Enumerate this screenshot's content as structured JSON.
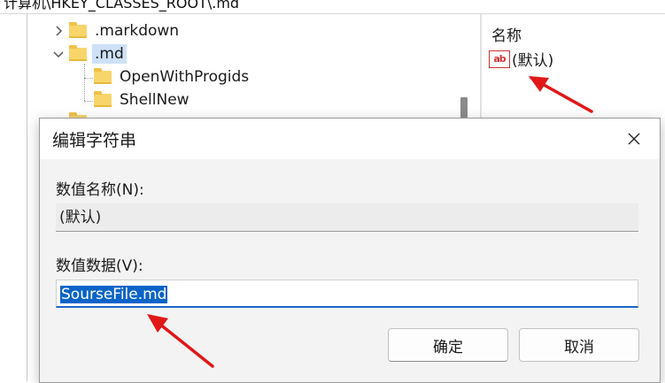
{
  "address_bar": {
    "path": "计算机\\HKEY_CLASSES_ROOT\\.md"
  },
  "tree": {
    "items": [
      {
        "label": ".markdown",
        "expanded": false
      },
      {
        "label": ".md",
        "expanded": true,
        "selected": true
      },
      {
        "label": "OpenWithProgids"
      },
      {
        "label": "ShellNew"
      }
    ]
  },
  "values_pane": {
    "column_name": "名称",
    "rows": [
      {
        "icon": "string-value-icon",
        "icon_text": "ab",
        "name": "(默认)"
      }
    ]
  },
  "dialog": {
    "title": "编辑字符串",
    "name_label": "数值名称(N):",
    "name_value": "(默认)",
    "data_label": "数值数据(V):",
    "data_value": "SourseFile.md",
    "ok_label": "确定",
    "cancel_label": "取消"
  },
  "colors": {
    "accent": "#0a64c8",
    "annotation_arrow": "#e01818",
    "folder": "#f8d56b"
  }
}
